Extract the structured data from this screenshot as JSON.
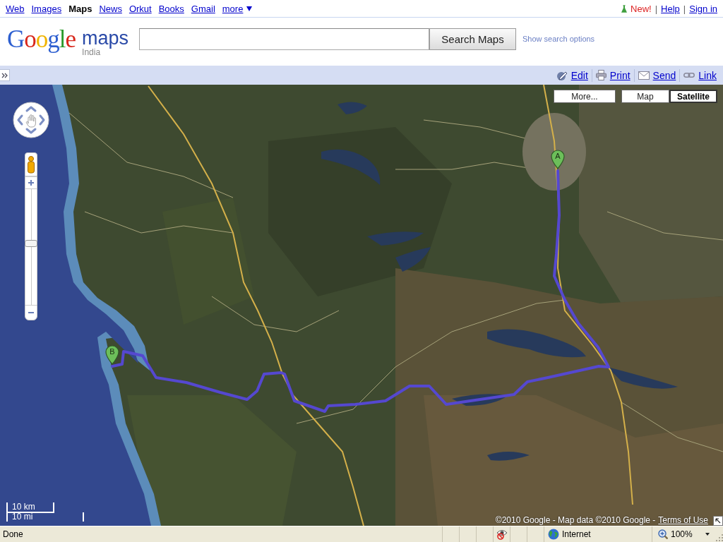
{
  "top_nav": {
    "links": [
      {
        "kind": "link",
        "label": "Web",
        "selected": false
      },
      {
        "kind": "link",
        "label": "Images",
        "selected": false
      },
      {
        "kind": "link",
        "label": "Maps",
        "selected": true
      },
      {
        "kind": "link",
        "label": "News",
        "selected": false
      },
      {
        "kind": "link",
        "label": "Orkut",
        "selected": false
      },
      {
        "kind": "link",
        "label": "Books",
        "selected": false
      },
      {
        "kind": "link",
        "label": "Gmail",
        "selected": false
      },
      {
        "kind": "menu",
        "label": "more",
        "selected": false
      }
    ],
    "account": [
      {
        "kind": "new",
        "label": "New!"
      },
      {
        "kind": "separator",
        "label": "|"
      },
      {
        "kind": "link",
        "label": "Help"
      },
      {
        "kind": "separator",
        "label": "|"
      },
      {
        "kind": "link",
        "label": "Sign in"
      }
    ]
  },
  "header": {
    "logo": {
      "wordmark": "Google",
      "product": "maps",
      "region": "India"
    },
    "search": {
      "button": "Search Maps",
      "options_link": "Show search options"
    }
  },
  "toolbar": {
    "actions": [
      {
        "kind": "edit",
        "label": "Edit"
      },
      {
        "kind": "print",
        "label": "Print"
      },
      {
        "kind": "send",
        "label": "Send"
      },
      {
        "kind": "link",
        "label": "Link"
      }
    ]
  },
  "map": {
    "more_button": "More...",
    "map_types": [
      {
        "label": "Map",
        "selected": false
      },
      {
        "label": "Satellite",
        "selected": true
      }
    ],
    "zoom": {
      "level": 0.53
    },
    "markers": [
      {
        "label": "A"
      },
      {
        "label": "B"
      }
    ],
    "scale": {
      "metric": "10 km",
      "imperial": "10 mi"
    },
    "attribution": "©2010 Google - Map data ©2010 Google -",
    "terms_link": "Terms of Use"
  },
  "status_bar": {
    "message": "Done",
    "zone": "Internet",
    "zoom": "100%"
  }
}
